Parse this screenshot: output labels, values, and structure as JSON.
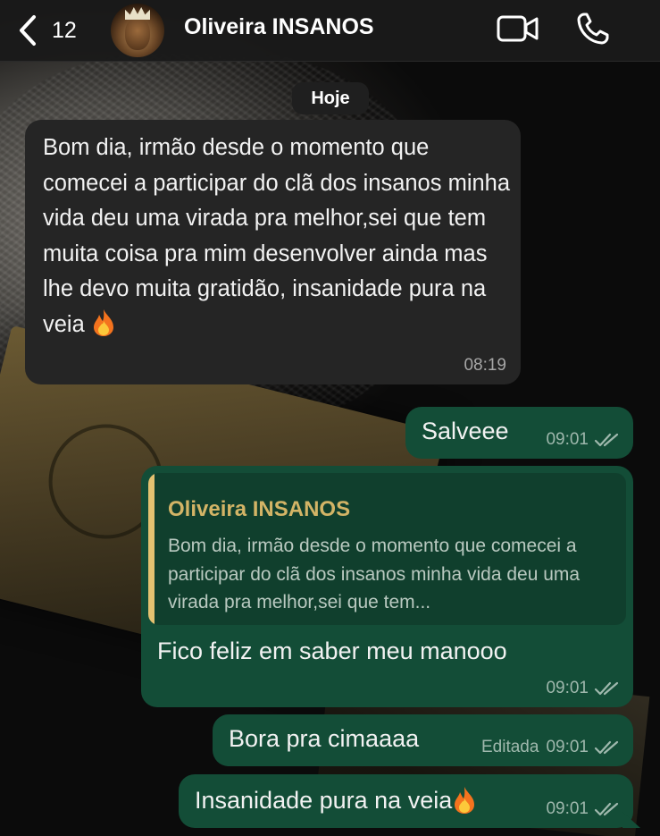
{
  "header": {
    "back_count": "12",
    "contact_name": "Oliveira INSANOS",
    "icons": [
      "back-chevron-icon",
      "video-camera-icon",
      "phone-icon"
    ]
  },
  "date_separator": "Hoje",
  "messages": [
    {
      "direction": "incoming",
      "text": "Bom dia, irmão desde o momento que comecei a participar do clã dos insanos minha vida deu uma virada pra melhor,sei que tem muita coisa pra mim desenvolver ainda mas lhe devo muita gratidão, insanidade pura na veia",
      "emoji": "fire-icon",
      "time": "08:19"
    },
    {
      "direction": "outgoing",
      "text": "Salveee",
      "time": "09:01",
      "status": "read"
    },
    {
      "direction": "outgoing",
      "reply_to": {
        "author": "Oliveira INSANOS",
        "text": "Bom dia, irmão desde o momento que comecei a participar do clã dos insanos minha vida deu uma virada pra melhor,sei que tem..."
      },
      "text": "Fico feliz em saber meu manooo",
      "time": "09:01",
      "status": "read"
    },
    {
      "direction": "outgoing",
      "text": "Bora pra cimaaaa",
      "edited_label": "Editada",
      "time": "09:01",
      "status": "read"
    },
    {
      "direction": "outgoing",
      "text": "Insanidade pura na veia",
      "emoji": "fire-icon",
      "time": "09:01",
      "status": "read"
    }
  ],
  "colors": {
    "incoming_bubble": "#252525",
    "outgoing_bubble": "#134d37",
    "quote_author": "#d3b466",
    "quote_bar": "#e4c170"
  }
}
